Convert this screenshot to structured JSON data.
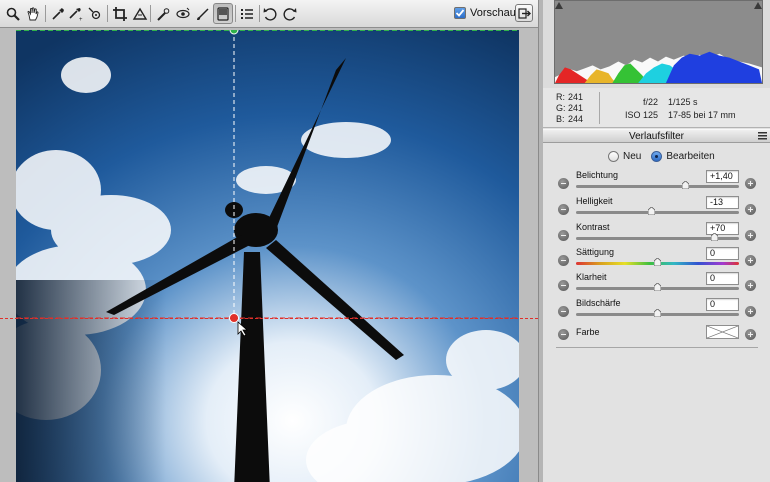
{
  "toolbar": {
    "tools": [
      {
        "icon": "zoom-icon"
      },
      {
        "icon": "hand-icon"
      },
      {
        "icon": "eyedropper-icon"
      },
      {
        "icon": "color-sampler-icon"
      },
      {
        "icon": "target-adjustment-icon"
      },
      {
        "icon": "crop-icon"
      },
      {
        "icon": "straighten-icon"
      },
      {
        "icon": "spot-removal-icon"
      },
      {
        "icon": "red-eye-icon"
      },
      {
        "icon": "adjustment-brush-icon"
      },
      {
        "icon": "graduated-filter-icon"
      },
      {
        "icon": "preferences-list-icon"
      },
      {
        "icon": "rotate-left-icon"
      },
      {
        "icon": "rotate-right-icon"
      }
    ],
    "active_tool": "graduated-filter-icon",
    "preview_label": "Vorschau",
    "preview_checked": true,
    "export_icon": "export-icon"
  },
  "info": {
    "r_label": "R:",
    "r_value": "241",
    "g_label": "G:",
    "g_value": "241",
    "b_label": "B:",
    "b_value": "244",
    "aperture": "f/22",
    "shutter": "1/125 s",
    "iso": "ISO 125",
    "lens": "17-85 bei 17 mm"
  },
  "panel": {
    "title": "Verlaufsfilter",
    "mode_new": "Neu",
    "mode_edit": "Bearbeiten",
    "mode_selected": "Bearbeiten",
    "sliders": [
      {
        "label": "Belichtung",
        "value": "+1,40",
        "fraction": 0.672
      },
      {
        "label": "Helligkeit",
        "value": "-13",
        "fraction": 0.465
      },
      {
        "label": "Kontrast",
        "value": "+70",
        "fraction": 0.85
      },
      {
        "label": "Sättigung",
        "value": "0",
        "fraction": 0.5,
        "rainbow": true
      },
      {
        "label": "Klarheit",
        "value": "0",
        "fraction": 0.5
      },
      {
        "label": "Bildschärfe",
        "value": "0",
        "fraction": 0.5
      }
    ],
    "color_label": "Farbe"
  },
  "colors": {
    "accent": "#2d6cc6",
    "guide_green": "#2fb24a",
    "guide_red": "#e0302a",
    "panel_bg": "#e2e2e2"
  }
}
